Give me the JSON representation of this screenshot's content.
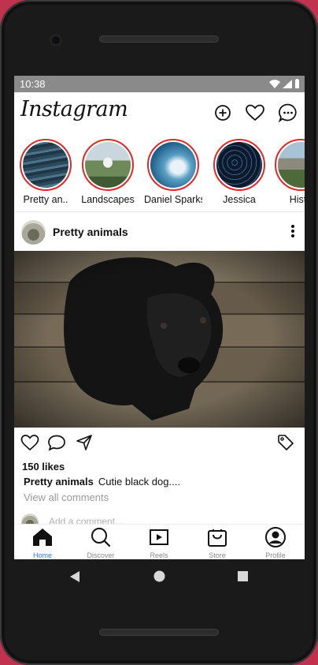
{
  "status": {
    "time": "10:38"
  },
  "app": {
    "logo": "Instagram"
  },
  "appbar_icons": [
    "add-post-icon",
    "heart-icon",
    "messenger-icon"
  ],
  "stories": [
    {
      "name": "Pretty an..",
      "theme": "waves"
    },
    {
      "name": "Landscapes",
      "theme": "castle"
    },
    {
      "name": "Daniel Sparks",
      "theme": "wave-blue"
    },
    {
      "name": "Jessica",
      "theme": "star-trails"
    },
    {
      "name": "Histo",
      "theme": "mountains"
    }
  ],
  "post": {
    "username": "Pretty animals",
    "likes": "150 likes",
    "caption_user": "Pretty animals",
    "caption_text": "Cutie black dog....",
    "view_all": "View all comments",
    "comment_placeholder": "Add a comment..."
  },
  "bottom_nav": [
    {
      "label": "Home",
      "icon": "home-icon",
      "active": true
    },
    {
      "label": "Discover",
      "icon": "search-icon",
      "active": false
    },
    {
      "label": "Reels",
      "icon": "reels-icon",
      "active": false
    },
    {
      "label": "Store",
      "icon": "shopping-bag-icon",
      "active": false
    },
    {
      "label": "Profile",
      "icon": "profile-icon",
      "active": false
    }
  ],
  "colors": {
    "story_ring": "#e02828",
    "active_nav": "#2c7be5",
    "status_bar": "#8a8a8a",
    "background": "#c0324e"
  }
}
